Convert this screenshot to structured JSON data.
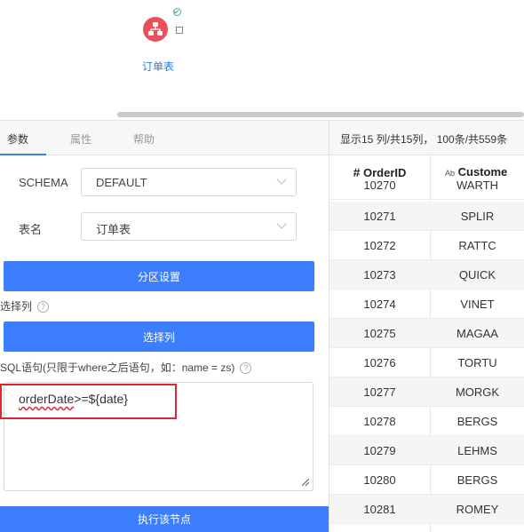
{
  "canvas": {
    "node_label": "订单表"
  },
  "tabs": [
    {
      "label": "参数",
      "active": true
    },
    {
      "label": "属性",
      "active": false
    },
    {
      "label": "帮助",
      "active": false
    }
  ],
  "form": {
    "schema_label": "SCHEMA",
    "schema_value": "DEFAULT",
    "table_label": "表名",
    "table_value": "订单表",
    "partition_button": "分区设置",
    "select_cols_label": "选择列",
    "select_cols_button": "选择列",
    "sql_label": "SQL语句(只限于where之后语句，如：name = zs)",
    "sql_value_underlined": "orderDate",
    "sql_value_rest": ">=${date}",
    "help_glyph": "?",
    "execute_button": "执行该节点"
  },
  "grid": {
    "info": "显示15 列/共15列， 100条/共559条",
    "columns": [
      {
        "type_glyph": "#",
        "name": "OrderID"
      },
      {
        "type_glyph": "Ab",
        "name": "Custome"
      }
    ],
    "rows": [
      [
        "10270",
        "WARTH"
      ],
      [
        "10271",
        "SPLIR"
      ],
      [
        "10272",
        "RATTC"
      ],
      [
        "10273",
        "QUICK"
      ],
      [
        "10274",
        "VINET"
      ],
      [
        "10275",
        "MAGAA"
      ],
      [
        "10276",
        "TORTU"
      ],
      [
        "10277",
        "MORGK"
      ],
      [
        "10278",
        "BERGS"
      ],
      [
        "10279",
        "LEHMS"
      ],
      [
        "10280",
        "BERGS"
      ],
      [
        "10281",
        "ROMEY"
      ]
    ]
  },
  "colors": {
    "primary": "#3d7eff",
    "highlight": "#e0262d",
    "node": "#e8505b",
    "success": "#3cb371"
  }
}
